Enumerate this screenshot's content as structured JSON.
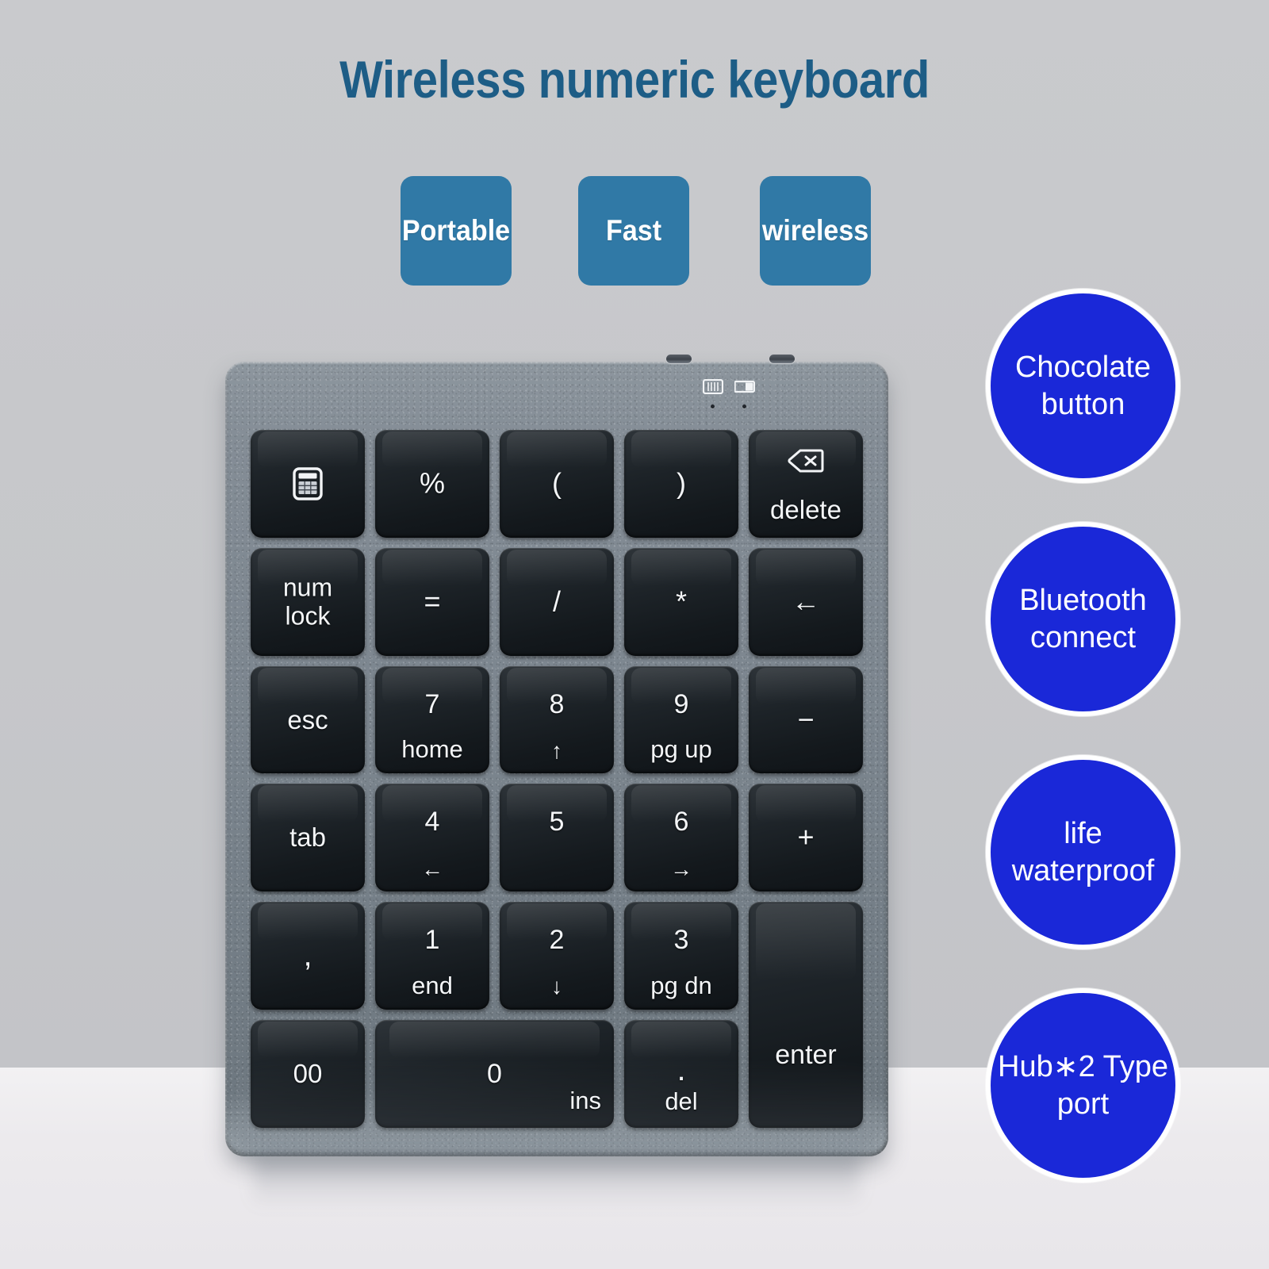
{
  "title": "Wireless numeric keyboard",
  "colors": {
    "title": "#1d5d86",
    "chip_bg": "#3079a6",
    "feature_bg": "#1a28d8",
    "backdrop": "#c6c7ca",
    "table": "#eceaed",
    "keyboard_body": "#79838c",
    "key": "#151a1f"
  },
  "chips": [
    {
      "label": "Portable"
    },
    {
      "label": "Fast"
    },
    {
      "label": "wireless"
    }
  ],
  "features": [
    {
      "label": "Chocolate\nbutton"
    },
    {
      "label": "Bluetooth\nconnect"
    },
    {
      "label": "life\nwaterproof"
    },
    {
      "label": "Hub∗2\nType port"
    }
  ],
  "keyboard": {
    "indicators": [
      {
        "name": "bluetooth-indicator-icon"
      },
      {
        "name": "battery-indicator-icon"
      }
    ],
    "ports": [
      {
        "name": "usb-c-port-1"
      },
      {
        "name": "usb-c-port-2"
      }
    ],
    "rows": [
      [
        {
          "id": "calculator",
          "icon": "calculator-icon",
          "main": "",
          "sub": ""
        },
        {
          "id": "percent",
          "center": "%"
        },
        {
          "id": "paren-open",
          "center": "("
        },
        {
          "id": "paren-close",
          "center": ")"
        },
        {
          "id": "delete",
          "icon": "backspace-icon",
          "label": "delete"
        }
      ],
      [
        {
          "id": "num-lock",
          "center": "num\nlock"
        },
        {
          "id": "equals",
          "center": "="
        },
        {
          "id": "divide",
          "center": "/"
        },
        {
          "id": "multiply",
          "center": "*"
        },
        {
          "id": "arrow-left-key",
          "center": "←"
        }
      ],
      [
        {
          "id": "esc",
          "center": "esc"
        },
        {
          "id": "key-7",
          "main": "7",
          "sub": "home"
        },
        {
          "id": "key-8",
          "main": "8",
          "sub": "↑"
        },
        {
          "id": "key-9",
          "main": "9",
          "sub": "pg up"
        },
        {
          "id": "minus",
          "center": "−"
        }
      ],
      [
        {
          "id": "tab",
          "center": "tab"
        },
        {
          "id": "key-4",
          "main": "4",
          "sub": "←"
        },
        {
          "id": "key-5",
          "main": "5",
          "sub": ""
        },
        {
          "id": "key-6",
          "main": "6",
          "sub": "→"
        },
        {
          "id": "plus",
          "center": "+"
        }
      ],
      [
        {
          "id": "comma",
          "center": ","
        },
        {
          "id": "key-1",
          "main": "1",
          "sub": "end"
        },
        {
          "id": "key-2",
          "main": "2",
          "sub": "↓"
        },
        {
          "id": "key-3",
          "main": "3",
          "sub": "pg dn"
        },
        {
          "id": "enter",
          "label": "enter"
        }
      ],
      [
        {
          "id": "double-zero",
          "center": "00"
        },
        {
          "id": "zero",
          "main": "0",
          "sub": "ins"
        },
        {
          "id": "period",
          "main": ".",
          "sub": "del"
        }
      ]
    ]
  }
}
